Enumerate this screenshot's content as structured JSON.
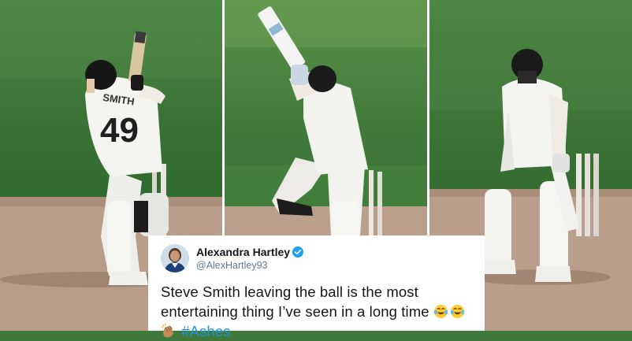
{
  "player_left": {
    "shirt_name": "SMITH",
    "shirt_number": "49"
  },
  "tweet": {
    "display_name": "Alexandra Hartley",
    "handle": "@AlexHartley93",
    "text": "Steve Smith leaving the ball is the most entertaining thing I’ve seen in a long time",
    "hashtag": "#Ashes",
    "emojis": [
      "tears-of-joy",
      "tears-of-joy",
      "clapping-hands"
    ]
  },
  "colors": {
    "grass": "#3f7a3a",
    "pitch": "#b79a88",
    "kit": "#f3f3f1",
    "hashtag": "#1b95e0",
    "verified": "#1da1f2"
  }
}
